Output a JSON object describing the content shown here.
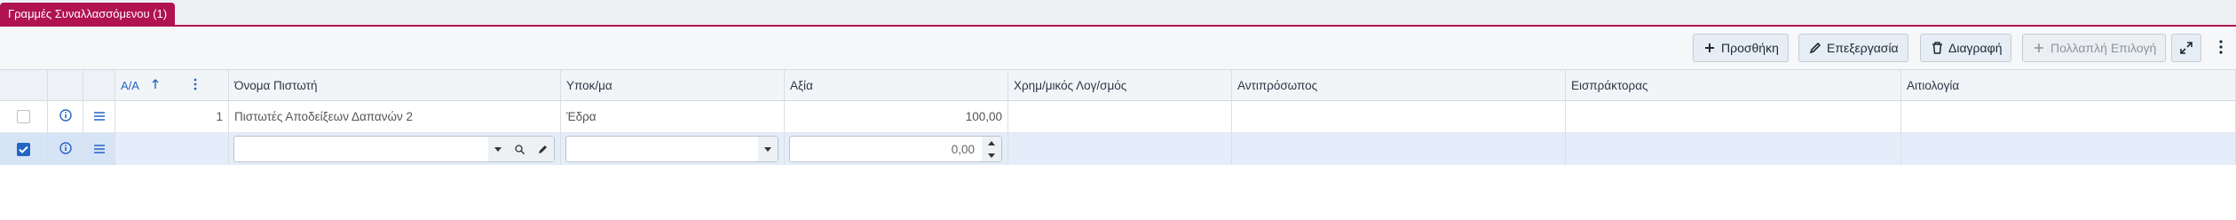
{
  "tab": {
    "title": "Γραμμές Συναλλασσόμενου (1)"
  },
  "toolbar": {
    "add_label": "Προσθήκη",
    "edit_label": "Επεξεργασία",
    "delete_label": "Διαγραφή",
    "multi_label": "Πολλαπλή Επιλογή"
  },
  "grid": {
    "columns": {
      "aa": "Α/Α",
      "payee": "Όνομα Πιστωτή",
      "subaccount": "Υποκ/μα",
      "value": "Αξία",
      "financial_account": "Χρημ/μικός Λογ/σμός",
      "representative": "Αντιπρόσωπος",
      "collector": "Εισπράκτορας",
      "reason": "Αιτιολογία"
    },
    "rows": [
      {
        "aa": "1",
        "payee": "Πιστωτές Αποδείξεων Δαπανών 2",
        "subaccount": "Έδρα",
        "value": "100,00",
        "financial_account": "",
        "representative": "",
        "collector": "",
        "reason": ""
      }
    ],
    "edit_row": {
      "payee": "",
      "subaccount": "",
      "value": "0,00"
    }
  },
  "colors": {
    "accent": "#b0134f",
    "primary": "#2464c4",
    "selected_row": "#e4edf9"
  },
  "icons": [
    "plus-icon",
    "pencil-icon",
    "trash-icon",
    "expand-icon",
    "kebab-icon",
    "info-icon",
    "menu-icon",
    "sort-up-icon"
  ]
}
